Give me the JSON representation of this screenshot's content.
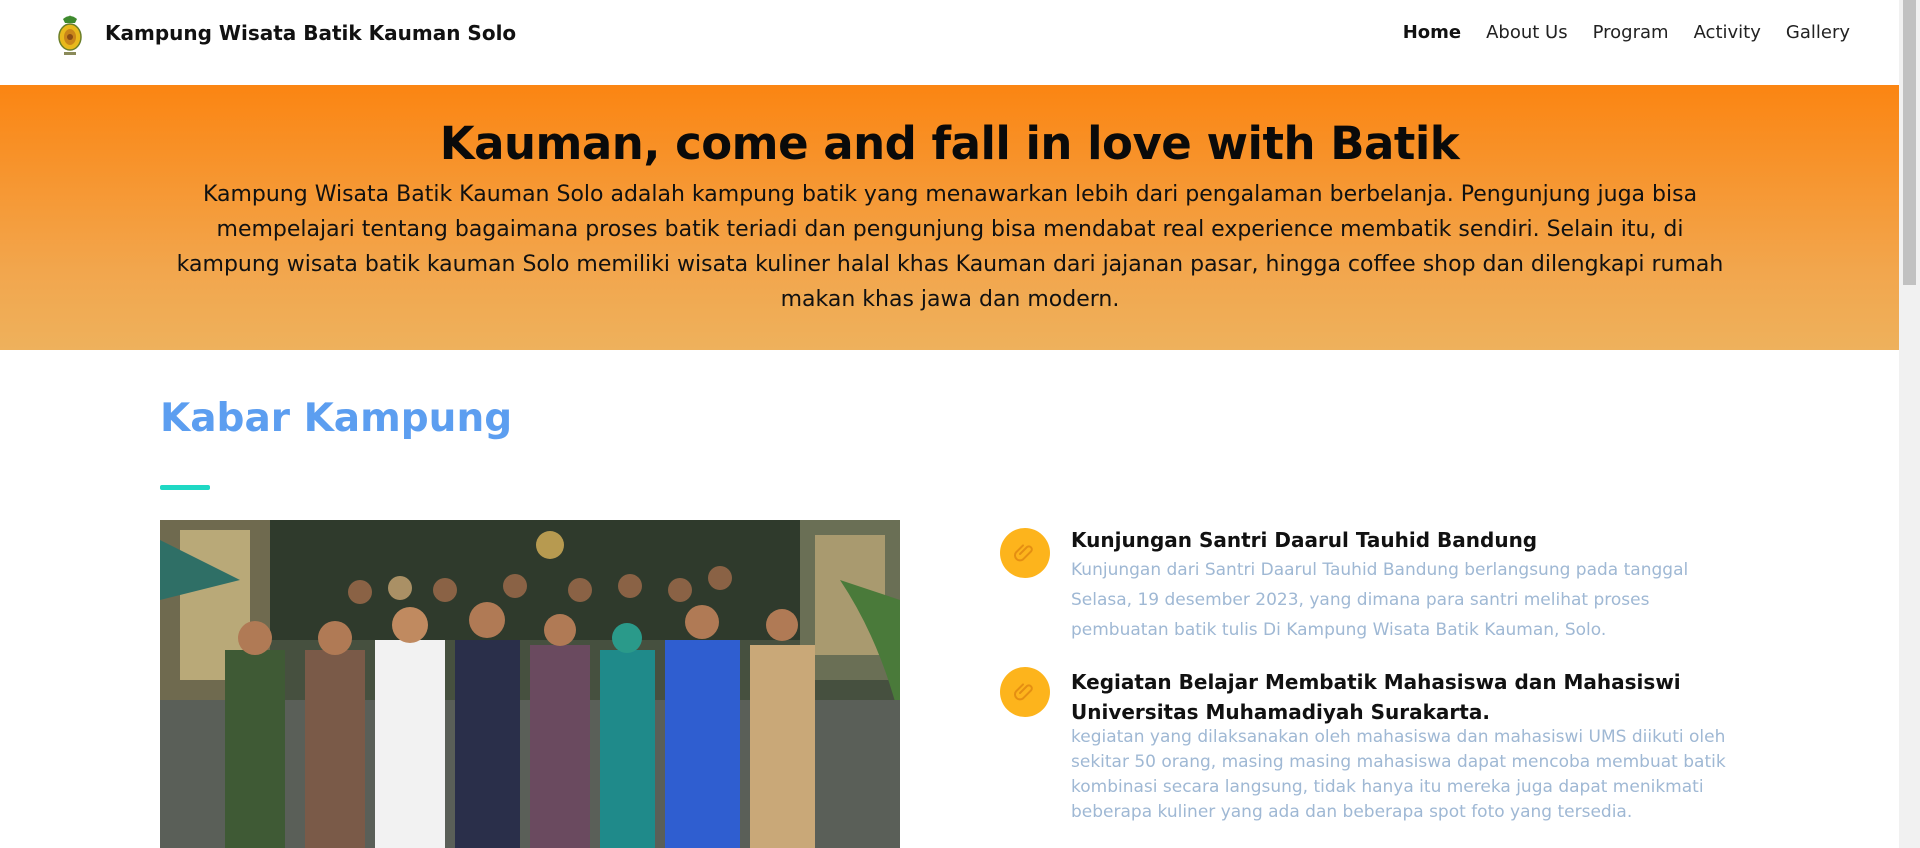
{
  "nav": {
    "brand": "Kampung Wisata Batik Kauman Solo",
    "links": [
      "Home",
      "About Us",
      "Program",
      "Activity",
      "Gallery"
    ],
    "active": "Home"
  },
  "hero": {
    "title": "Kauman, come and fall in love with Batik",
    "description": "Kampung Wisata Batik Kauman Solo adalah kampung batik yang menawarkan lebih dari pengalaman berbelanja. Pengunjung juga bisa mempelajari tentang bagaimana proses batik teriadi dan pengunjung bisa mendabat real experience membatik sendiri. Selain itu, di kampung wisata batik kauman Solo memiliki wisata kuliner halal khas Kauman dari jajanan pasar, hingga coffee shop dan dilengkapi rumah makan khas jawa dan modern."
  },
  "news_section": {
    "title": "Kabar Kampung",
    "items": [
      {
        "title": "Kunjungan Santri Daarul Tauhid Bandung",
        "description": "Kunjungan dari Santri Daarul Tauhid Bandung berlangsung pada tanggal Selasa, 19 desember 2023, yang dimana para santri melihat proses pembuatan batik tulis Di Kampung Wisata Batik Kauman, Solo.",
        "icon": "paperclip-icon"
      },
      {
        "title": "Kegiatan Belajar Membatik Mahasiswa dan Mahasiswi Universitas Muhamadiyah Surakarta.",
        "description": "kegiatan yang dilaksanakan oleh mahasiswa dan mahasiswi UMS diikuti oleh sekitar 50 orang, masing masing mahasiswa dapat mencoba membuat batik kombinasi secara langsung, tidak hanya itu mereka juga dapat menikmati beberapa kuliner yang ada dan beberapa spot foto yang tersedia.",
        "icon": "paperclip-icon"
      }
    ]
  },
  "colors": {
    "hero_top": "#fb8512",
    "hero_bottom": "#eeb15c",
    "section_title": "#5c9ef0",
    "underline": "#1fd8c4",
    "icon_bg": "#fdb41c",
    "desc_text": "#9fb8d4"
  }
}
